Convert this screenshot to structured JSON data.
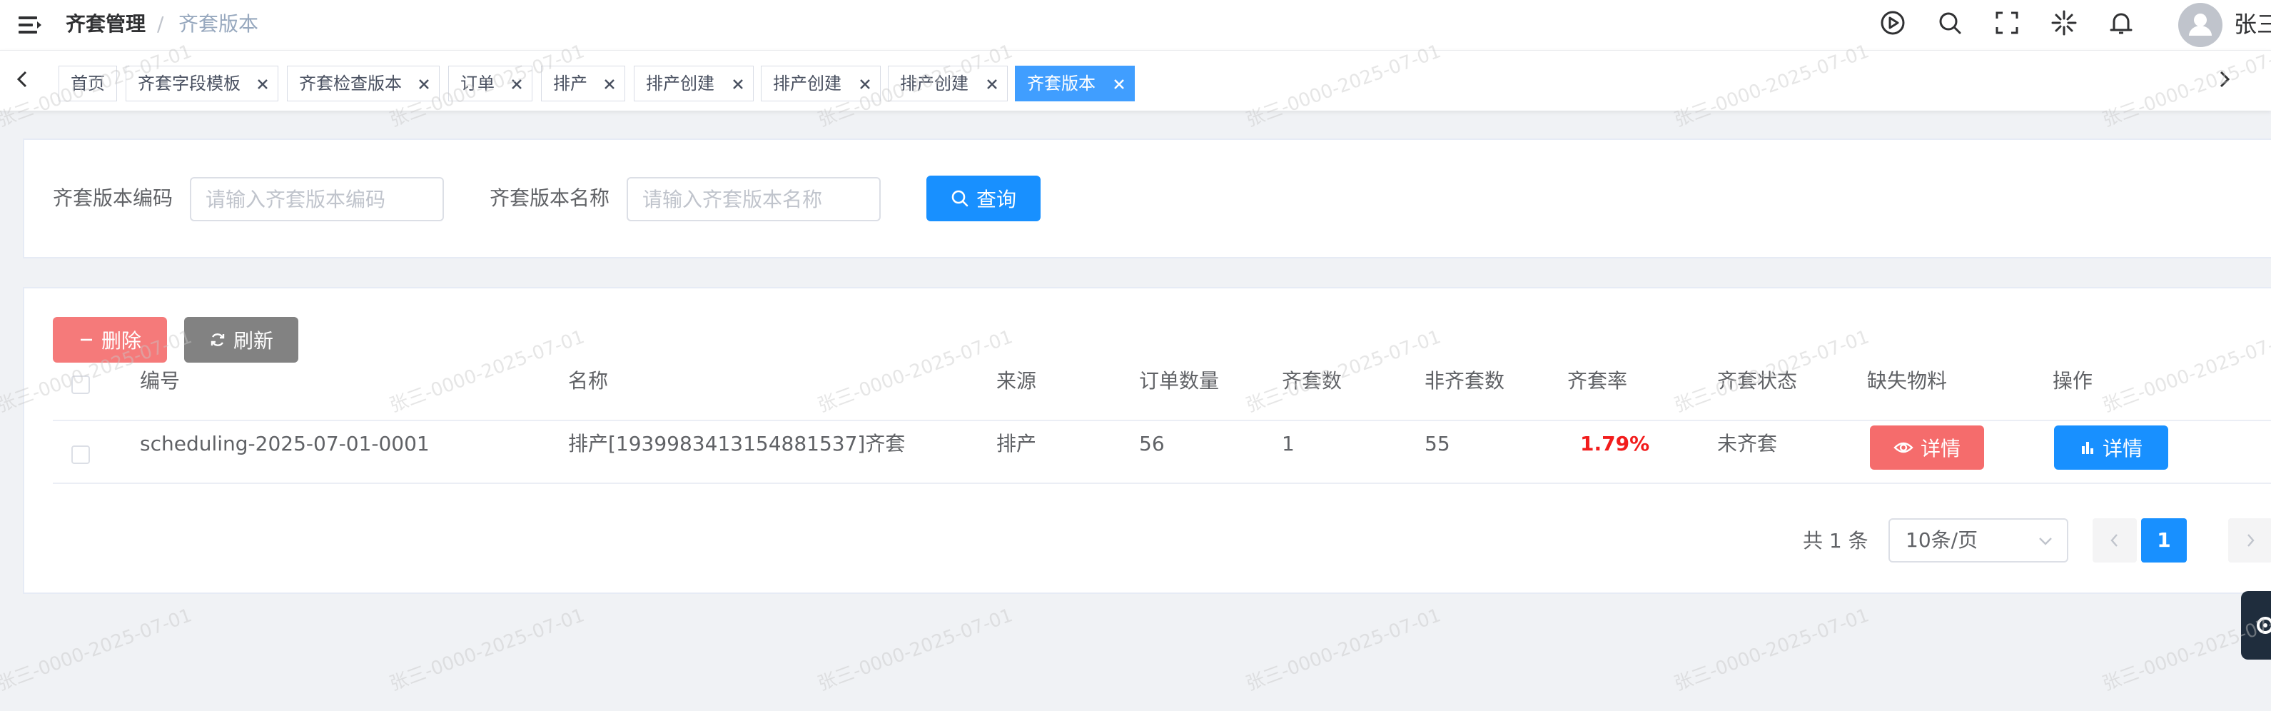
{
  "header": {
    "breadcrumb": [
      "齐套管理",
      "齐套版本"
    ],
    "breadcrumb_separator": "/",
    "username": "张三"
  },
  "tags": [
    {
      "label": "首页",
      "closable": false,
      "active": false
    },
    {
      "label": "齐套字段模板",
      "closable": true,
      "active": false
    },
    {
      "label": "齐套检查版本",
      "closable": true,
      "active": false
    },
    {
      "label": "订单",
      "closable": true,
      "active": false
    },
    {
      "label": "排产",
      "closable": true,
      "active": false
    },
    {
      "label": "排产创建",
      "closable": true,
      "active": false
    },
    {
      "label": "排产创建",
      "closable": true,
      "active": false
    },
    {
      "label": "排产创建",
      "closable": true,
      "active": false
    },
    {
      "label": "齐套版本",
      "closable": true,
      "active": true
    }
  ],
  "search": {
    "code_label": "齐套版本编码",
    "code_placeholder": "请输入齐套版本编码",
    "code_value": "",
    "name_label": "齐套版本名称",
    "name_placeholder": "请输入齐套版本名称",
    "name_value": "",
    "query_button": "查询"
  },
  "toolbar": {
    "delete_button": "删除",
    "refresh_button": "刷新"
  },
  "table": {
    "columns": [
      "编号",
      "名称",
      "来源",
      "订单数量",
      "齐套数",
      "非齐套数",
      "齐套率",
      "齐套状态",
      "缺失物料",
      "操作"
    ],
    "rows": [
      {
        "code": "scheduling-2025-07-01-0001",
        "name": "排产[1939983413154881537]齐套",
        "source": "排产",
        "order_count": "56",
        "kit_count": "1",
        "non_kit_count": "55",
        "kit_rate": "1.79%",
        "status": "未齐套",
        "missing_button": "详情",
        "action_button": "详情"
      }
    ]
  },
  "pagination": {
    "total_text": "共 1 条",
    "page_size": "10条/页",
    "current_page": "1"
  },
  "watermark": "张三-0000-2025-07-01",
  "colors": {
    "primary": "#1890ff",
    "danger": "#f56c6c",
    "refresh": "#828282",
    "rate": "#f21c1c",
    "tag_active": "#409eff"
  }
}
